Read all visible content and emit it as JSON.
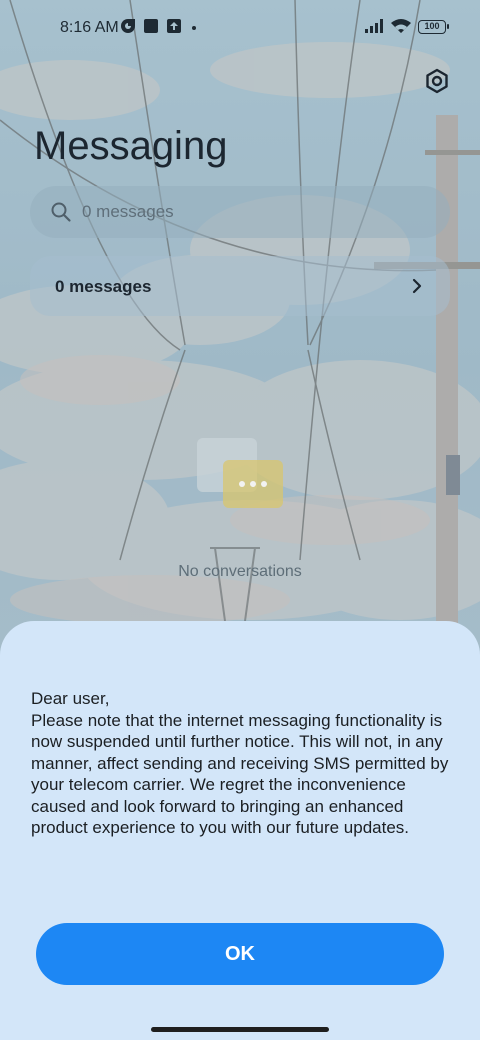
{
  "status_bar": {
    "time": "8:16 AM",
    "battery": "100",
    "icons": [
      "vpn-key-icon",
      "notification-square-icon",
      "upload-arrow-icon",
      "dot-icon",
      "signal-icon",
      "wifi-icon",
      "battery-icon"
    ]
  },
  "header": {
    "title": "Messaging",
    "settings_icon": "settings-hexagon-icon"
  },
  "search": {
    "placeholder": "0 messages"
  },
  "groups": {
    "row_label": "0 messages"
  },
  "empty_state": {
    "text": "No conversations"
  },
  "dialog": {
    "message": "Dear user,\nPlease note that the internet messaging functionality is now suspended until further notice. This will not, in any manner, affect sending and receiving SMS permitted by your telecom carrier. We regret the inconvenience caused and look forward to bringing an enhanced product experience to you with our future updates.",
    "ok_label": "OK"
  },
  "colors": {
    "sheet_bg": "#d3e6f9",
    "ok_button": "#1d87f4",
    "title_text": "#1c2630"
  }
}
